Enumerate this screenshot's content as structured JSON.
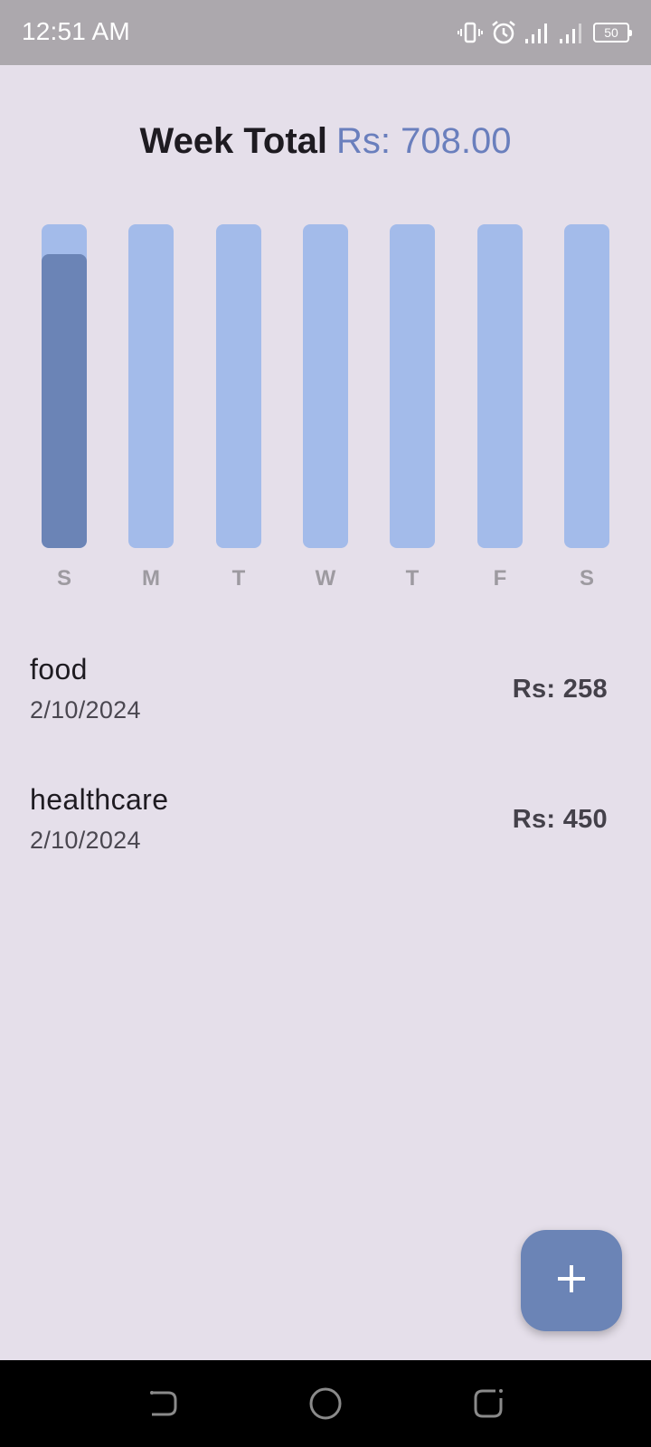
{
  "status_bar": {
    "time": "12:51 AM",
    "battery": "50",
    "icons": [
      "vibrate-icon",
      "alarm-icon",
      "signal-icon",
      "signal-icon",
      "battery-icon"
    ]
  },
  "summary": {
    "label": "Week Total",
    "value": "Rs: 708.00"
  },
  "chart_data": {
    "type": "bar",
    "categories": [
      "S",
      "M",
      "T",
      "W",
      "T",
      "F",
      "S"
    ],
    "values": [
      708,
      0,
      0,
      0,
      0,
      0,
      0
    ],
    "ylim": [
      0,
      780
    ],
    "colors": {
      "track": "#a3bbea",
      "fill": "#6b84b6"
    }
  },
  "expenses": [
    {
      "title": "food",
      "date": "2/10/2024",
      "amount": "Rs: 258"
    },
    {
      "title": "healthcare",
      "date": "2/10/2024",
      "amount": "Rs: 450"
    }
  ],
  "fab": {
    "icon": "plus-icon"
  },
  "navigation": {
    "icons": [
      "back-icon",
      "home-icon",
      "recents-icon"
    ]
  },
  "colors": {
    "background": "#e5dfea",
    "status_bar": "#aca8ad",
    "accent": "#6b84b6",
    "total_value": "#6a7fbd"
  }
}
